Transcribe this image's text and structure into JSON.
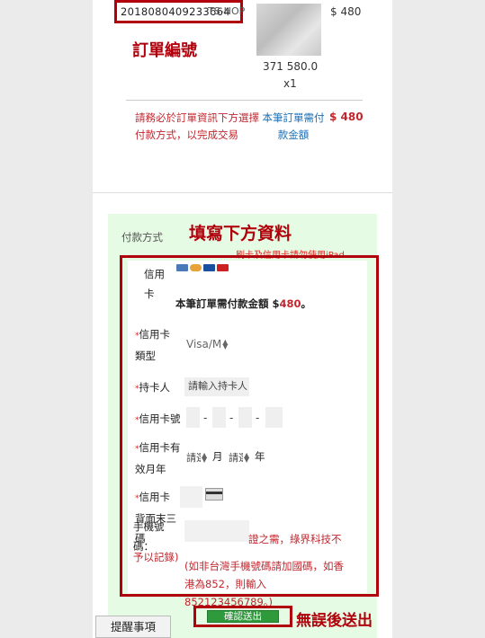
{
  "order": {
    "number": "2018080409233664",
    "suffix": "TS-HOP",
    "price": "$ 480",
    "annotation": "訂單編號",
    "item_line1": "371 580.0",
    "item_line2": "x1"
  },
  "notice": {
    "text": "請務必於訂單資訊下方選擇付款方式，以完成交易",
    "need_label": "本筆訂單需付款金額",
    "need_amount": "$ 480"
  },
  "payment": {
    "section_label": "付款方式",
    "fill_annotation": "填寫下方資料",
    "overlay_text": "刷卡及信用卡請勿使用iPad",
    "method": "信用卡",
    "card_brand_colors": [
      "#4a7ab8",
      "#e8a33b",
      "#1b4fa0",
      "#cc2222"
    ],
    "amount_prefix": "本筆訂單需付款金額 $",
    "amount_value": "480",
    "amount_suffix": "。"
  },
  "form": {
    "card_type_label": "信用卡類型",
    "card_type_value": "Visa/M",
    "holder_label": "持卡人",
    "holder_placeholder": "請輸入持卡人",
    "card_no_label": "信用卡號",
    "expiry_label": "信用卡有效月年",
    "expiry_month": "請選",
    "month_text": "月",
    "expiry_year": "請選",
    "year_text": "年",
    "cvv_label": "信用卡背面末三碼",
    "phone_label": "手機號碼：",
    "phone_note": "證之需，綠界科技不予以記錄)",
    "phone_hint": "(如非台灣手機號碼請加國碼，如香港為852，則輸入852123456789。)"
  },
  "actions": {
    "submit_label": "確認送出",
    "submit_annotation": "無誤後送出",
    "remind_label": "提醒事項"
  }
}
